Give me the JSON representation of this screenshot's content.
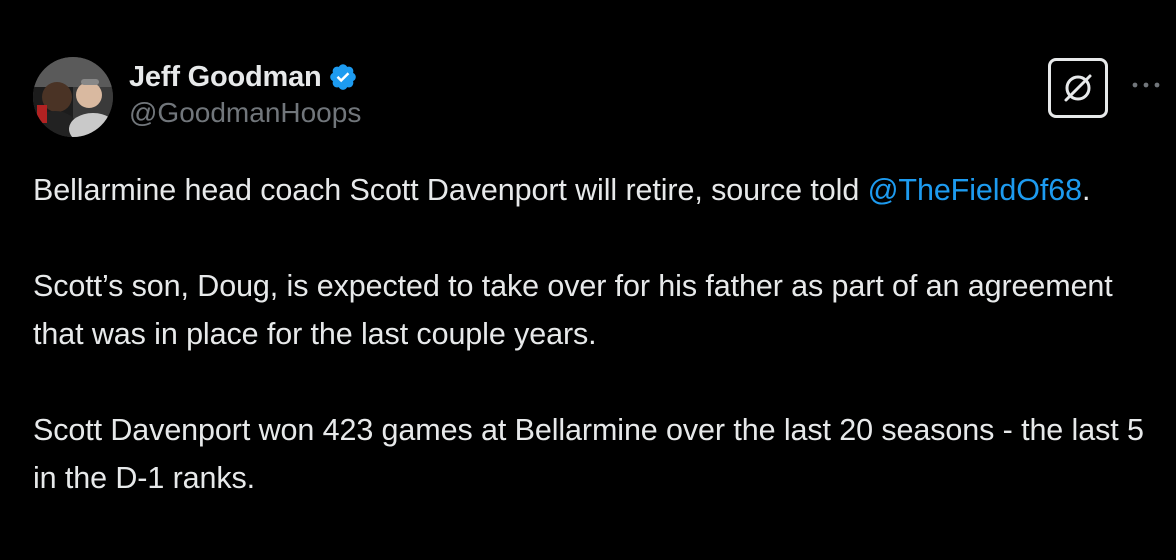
{
  "author": {
    "display_name": "Jeff Goodman",
    "handle": "@GoodmanHoops",
    "verified": true,
    "verified_icon": "verified-badge-icon",
    "avatar_icon": "avatar-photo"
  },
  "actions": {
    "grok_icon": "grok-icon",
    "more_icon": "more-dots-icon"
  },
  "tweet": {
    "para1_text": "Bellarmine head coach Scott Davenport will retire, source told",
    "para1_mention": "@TheFieldOf68",
    "para1_end": ".",
    "para2": "Scott’s son, Doug, is expected to take over for his father as part of an agreement that was in place for the last couple years.",
    "para3": "Scott Davenport won 423 games at Bellarmine over the last 20 seasons - the last 5 in the D-1 ranks."
  },
  "colors": {
    "background": "#000000",
    "text": "#e7e9ea",
    "secondary": "#71767b",
    "link": "#1d9bf0",
    "verified": "#1d9bf0"
  }
}
